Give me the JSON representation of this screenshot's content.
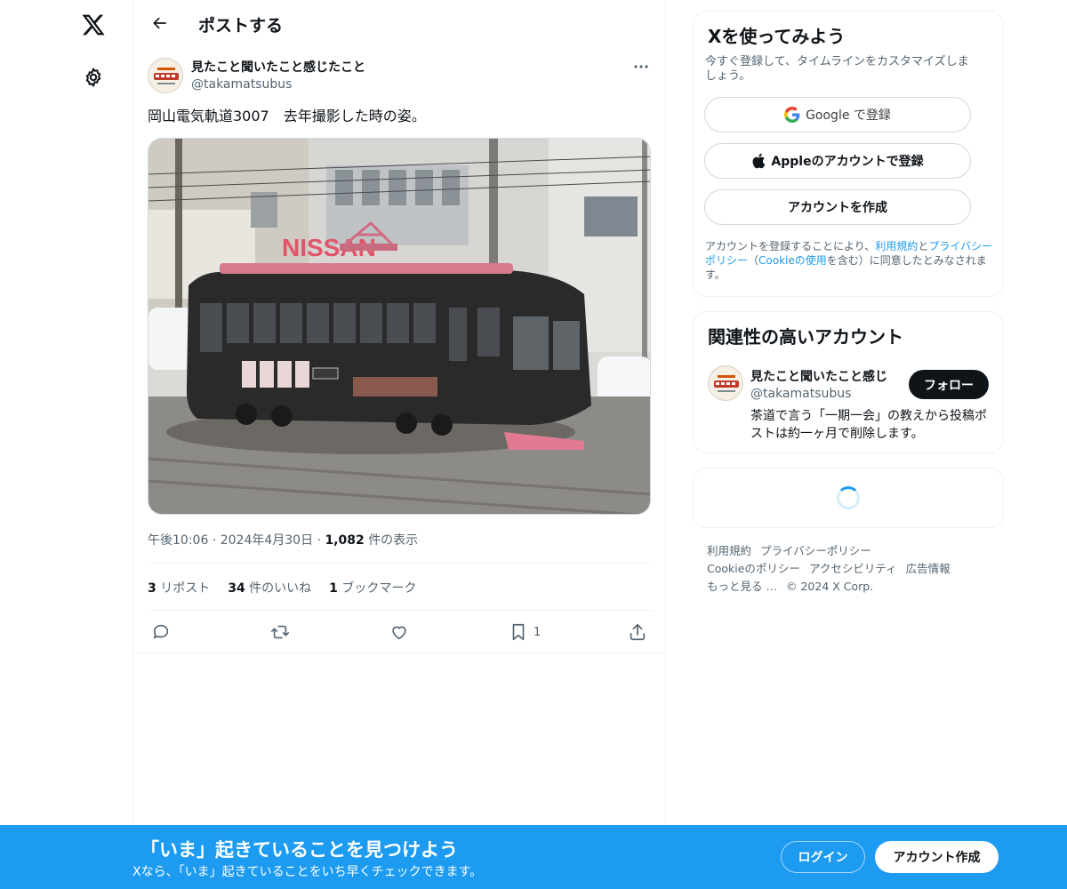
{
  "nav": {
    "logo_icon": "x-logo-icon",
    "settings_icon": "gear-icon"
  },
  "header": {
    "back_icon": "arrow-left-icon",
    "title": "ポストする"
  },
  "post": {
    "author_name": "見たこと聞いたこと感じたこと",
    "author_handle": "@takamatsubus",
    "more_icon": "more-horizontal-icon",
    "text": "岡山電気軌道3007　去年撮影した時の姿。",
    "media_description_icon": "tram-photo",
    "time": "午後10:06",
    "sep1": "·",
    "date": "2024年4月30日",
    "sep2": "·",
    "views_count": "1,082",
    "views_label": "件の表示",
    "reposts_count": "3",
    "reposts_label": "リポスト",
    "likes_count": "34",
    "likes_label": "件のいいね",
    "bookmarks_count": "1",
    "bookmarks_label": "ブックマーク",
    "bookmark_action_count": "1"
  },
  "signup_card": {
    "title": "Xを使ってみよう",
    "subtitle": "今すぐ登録して、タイムラインをカスタマイズしましょう。",
    "google_label": "Google で登録",
    "apple_label": "Appleのアカウントで登録",
    "create_label": "アカウントを作成",
    "legal_1": "アカウントを登録することにより、",
    "legal_terms": "利用規約",
    "legal_2": "と",
    "legal_privacy": "プライバシーポリシー",
    "legal_3": "（",
    "legal_cookie": "Cookieの使用",
    "legal_4": "を含む）に同意したとみなされます。"
  },
  "related_card": {
    "title": "関連性の高いアカウント",
    "name": "見たこと聞いたこと感じ",
    "handle": "@takamatsubus",
    "bio": "茶道で言う「一期一会」の教えから投稿ポストは約一ヶ月で削除します。",
    "follow_label": "フォロー"
  },
  "footer": {
    "terms": "利用規約",
    "privacy": "プライバシーポリシー",
    "cookie": "Cookieのポリシー",
    "accessibility": "アクセシビリティ",
    "ads": "広告情報",
    "more": "もっと見る …",
    "copyright": "© 2024 X Corp."
  },
  "bottom_bar": {
    "title": "「いま」起きていることを見つけよう",
    "subtitle": "Xなら、「いま」起きていることをいち早くチェックできます。",
    "login_label": "ログイン",
    "signup_label": "アカウント作成"
  },
  "colors": {
    "accent": "#1d9bf0",
    "text": "#0f1419",
    "muted": "#536471"
  }
}
